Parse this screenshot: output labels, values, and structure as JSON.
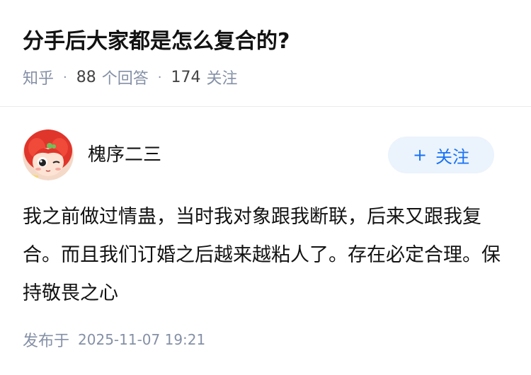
{
  "question": {
    "title": "分手后大家都是怎么复合的?",
    "source": "知乎",
    "answer_count": "88",
    "answer_label": "个回答",
    "follower_count": "174",
    "follower_label": "关注"
  },
  "answer": {
    "author_name": "槐序二三",
    "follow_button": {
      "icon": "plus-icon",
      "label": "关注"
    },
    "content": "我之前做过情蛊，当时我对象跟我断联，后来又跟我复合。而且我们订婚之后越来越粘人了。存在必定合理。保持敬畏之心",
    "published_label": "发布于",
    "published_time": "2025-11-07 19:21"
  },
  "colors": {
    "accent": "#1772f6",
    "follow_bg": "#ebf3fc",
    "meta_text": "#8590a6"
  }
}
